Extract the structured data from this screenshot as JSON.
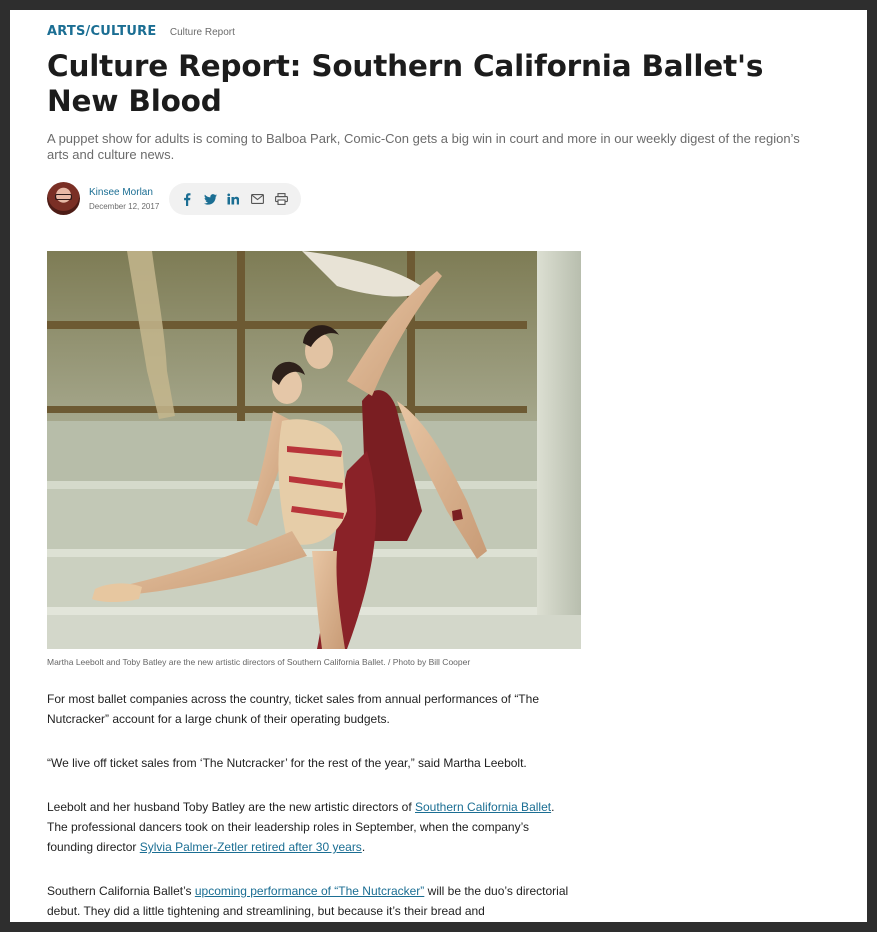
{
  "header": {
    "category": "ARTS/CULTURE",
    "series": "Culture Report"
  },
  "article": {
    "title": "Culture Report: Southern California Ballet's New Blood",
    "dek": "A puppet show for adults is coming to Balboa Park, Comic-Con gets a big win in court and more in our weekly digest of the region’s arts and culture news."
  },
  "byline": {
    "author": "Kinsee Morlan",
    "date": "December 12, 2017"
  },
  "share": {
    "icons": [
      "facebook-icon",
      "twitter-icon",
      "linkedin-icon",
      "email-icon",
      "print-icon"
    ]
  },
  "figure": {
    "caption": "Martha Leebolt and Toby Batley are the new artistic directors of Southern California Ballet. / Photo by Bill Cooper"
  },
  "body": {
    "p1": "For most ballet companies across the country, ticket sales from annual performances of “The Nutcracker” account for a large chunk of their operating budgets.",
    "p2": "“We live off ticket sales from ‘The Nutcracker’ for the rest of the year,” said Martha Leebolt.",
    "p3": {
      "before": "Leebolt and her husband Toby Batley are the new artistic directors of ",
      "link1": "Southern California Ballet",
      "middle": ". The professional dancers took on their leadership roles in September, when the company’s founding director ",
      "link2": "Sylvia Palmer-Zetler retired after 30 years",
      "after": "."
    },
    "p4": {
      "before": "Southern California Ballet’s ",
      "link": "upcoming performance of “The Nutcracker”",
      "after": " will be the duo’s directorial debut. They did a little tightening and streamlining, but because it’s their bread and"
    }
  },
  "colors": {
    "accent": "#1b6e93",
    "title": "#1c1c1c",
    "muted": "#6b6b6b"
  }
}
